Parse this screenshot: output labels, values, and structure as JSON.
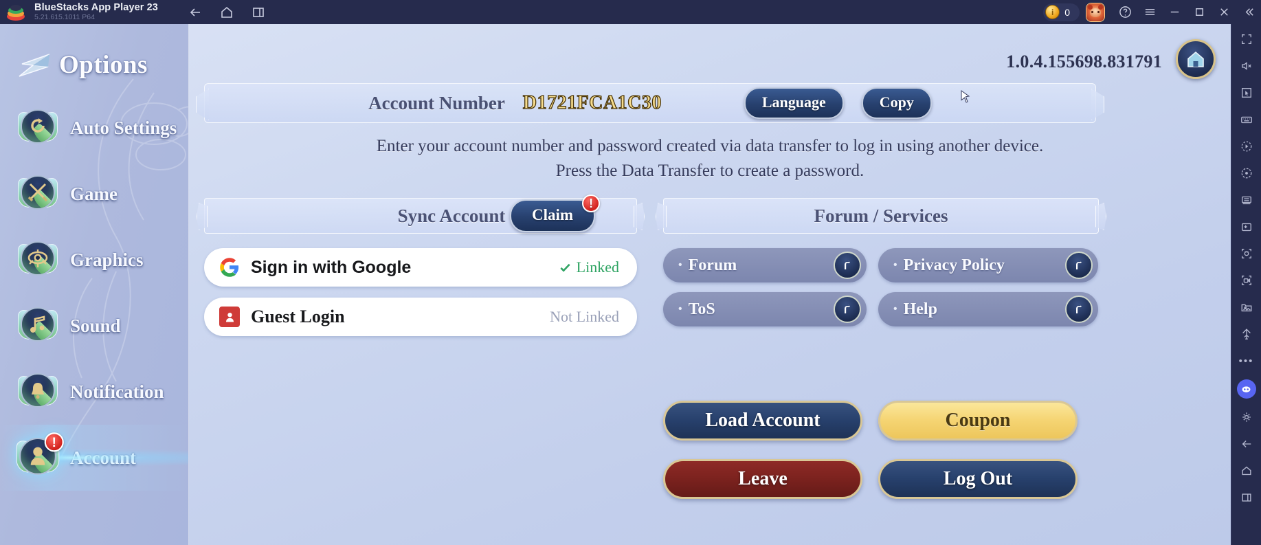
{
  "titlebar": {
    "app_title": "BlueStacks App Player 23",
    "app_version": "5.21.615.1011  P64",
    "nav": [
      {
        "name": "back-icon",
        "label": "Back"
      },
      {
        "name": "home-icon",
        "label": "Home"
      },
      {
        "name": "recents-icon",
        "label": "Recent apps"
      }
    ],
    "coin_count": "0",
    "buttons": [
      {
        "name": "help-icon",
        "label": "Help"
      },
      {
        "name": "hamburger-menu-icon",
        "label": "Menu"
      },
      {
        "name": "minimize-icon",
        "label": "Minimize"
      },
      {
        "name": "maximize-icon",
        "label": "Maximize"
      },
      {
        "name": "close-icon",
        "label": "Close"
      },
      {
        "name": "collapse-icon",
        "label": "Collapse"
      }
    ]
  },
  "right_toolbar": {
    "items": [
      "fullscreen-icon",
      "mute-icon",
      "cursor-icon",
      "keyboard-controls-icon",
      "macro-play-icon",
      "rotate-icon",
      "multi-instance-icon",
      "install-apk-icon",
      "screenshot-icon",
      "record-video-icon",
      "media-manager-icon",
      "eco-mode-icon",
      "more-icon",
      "discord-icon",
      "settings-gear-icon",
      "back-icon",
      "home-icon",
      "recents-icon"
    ]
  },
  "game": {
    "sidebar": {
      "header": "Options",
      "items": [
        {
          "label": "Auto Settings",
          "icon": "auto-settings-icon",
          "active": false,
          "badge": ""
        },
        {
          "label": "Game",
          "icon": "game-swords-icon",
          "active": false,
          "badge": ""
        },
        {
          "label": "Graphics",
          "icon": "graphics-eye-icon",
          "active": false,
          "badge": ""
        },
        {
          "label": "Sound",
          "icon": "sound-note-icon",
          "active": false,
          "badge": ""
        },
        {
          "label": "Notification",
          "icon": "notification-bell-icon",
          "active": false,
          "badge": ""
        },
        {
          "label": "Account",
          "icon": "account-person-icon",
          "active": true,
          "badge": "!"
        }
      ]
    },
    "version": "1.0.4.155698.831791",
    "home_button": "home-house-icon",
    "account_bar": {
      "label": "Account Number",
      "value": "D1721FCA1C30",
      "language_button": "Language",
      "copy_button": "Copy"
    },
    "description_line1": "Enter your account number and password created via data transfer to log in using another device.",
    "description_line2": "Press the Data Transfer to create a password.",
    "sync_section": {
      "title": "Sync Account",
      "claim_button": "Claim",
      "claim_badge": "!",
      "rows": [
        {
          "icon": "google-logo-icon",
          "label": "Sign in with Google",
          "status": "Linked",
          "linked": true
        },
        {
          "icon": "guest-person-icon",
          "label": "Guest Login",
          "status": "Not Linked",
          "linked": false
        }
      ]
    },
    "forum_section": {
      "title": "Forum / Services",
      "bullet": "•",
      "links": [
        {
          "label": "Forum",
          "icon": "external-link-icon"
        },
        {
          "label": "ToS",
          "icon": "external-link-icon"
        },
        {
          "label": "Privacy Policy",
          "icon": "external-link-icon"
        },
        {
          "label": "Help",
          "icon": "external-link-icon"
        }
      ]
    },
    "actions": [
      {
        "label": "Load Account",
        "style": "blue"
      },
      {
        "label": "Coupon",
        "style": "gold"
      },
      {
        "label": "Leave",
        "style": "red"
      },
      {
        "label": "Log Out",
        "style": "blue"
      }
    ]
  },
  "colors": {
    "titlebar_bg": "#262b4d",
    "account_value": "#f6dc8d",
    "linked_green": "#2fa463",
    "notlinked_gray": "#9aa1b8",
    "badge_red": "#d2221d",
    "gold_border": "#d9c795",
    "discord_purple": "#5865f2"
  }
}
